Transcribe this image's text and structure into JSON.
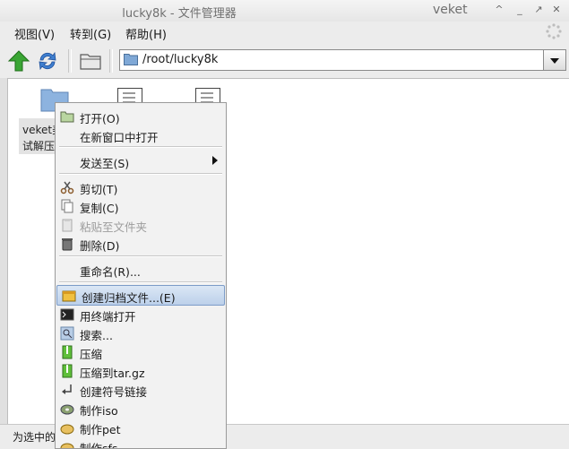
{
  "window": {
    "title": "lucky8k - 文件管理器",
    "app_name": "veket",
    "controls": [
      "^",
      "_",
      "↗",
      "✕"
    ]
  },
  "menubar": {
    "view": "视图(V)",
    "goto": "转到(G)",
    "help": "帮助(H)"
  },
  "toolbar": {
    "up_icon": "up-arrow-icon",
    "refresh_icon": "refresh-icon",
    "folder_icon": "folder-icon"
  },
  "location": {
    "path": "/root/lucky8k"
  },
  "files": [
    {
      "label_line1": "veket美",
      "label_line2": "试解压"
    }
  ],
  "status": {
    "text": "为选中的"
  },
  "context_menu": {
    "open": "打开(O)",
    "open_new_window": "在新窗口中打开",
    "send_to": "发送至(S)",
    "cut": "剪切(T)",
    "copy": "复制(C)",
    "paste_to_folder": "粘贴至文件夹",
    "delete": "删除(D)",
    "rename": "重命名(R)...",
    "create_archive": "创建归档文件...(E)",
    "open_terminal": "用终端打开",
    "search": "搜索...",
    "compress": "压缩",
    "compress_targz": "压缩到tar.gz",
    "create_symlink": "创建符号链接",
    "make_iso": "制作iso",
    "make_pet": "制作pet",
    "make_sfs": "制作sfs"
  },
  "colors": {
    "highlight": "#bcd0ea",
    "folder_blue": "#7fa8d6",
    "toolbar_green": "#3aa534"
  }
}
